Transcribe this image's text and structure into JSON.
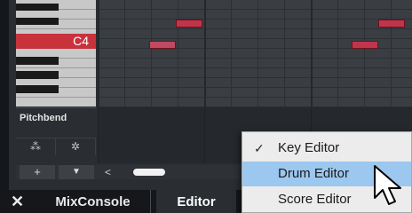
{
  "piano": {
    "c4_label": "C4"
  },
  "lane": {
    "title": "Pitchbend",
    "tool1_icon": "scatter-icon",
    "tool2_icon": "settings-icon"
  },
  "strip": {
    "add_label": "+",
    "dropdown_label": "▼",
    "scroll_left_label": "<"
  },
  "tabs": {
    "close_label": "✕",
    "mixconsole": "MixConsole",
    "editor": "Editor"
  },
  "menu": {
    "items": [
      {
        "label": "Key Editor",
        "checked": true
      },
      {
        "label": "Drum Editor",
        "highlighted": true
      },
      {
        "label": "Score Editor"
      }
    ]
  },
  "colors": {
    "note": "#c0354a",
    "key_selected": "#c8333b",
    "menu_highlight": "#9cc7ef"
  }
}
